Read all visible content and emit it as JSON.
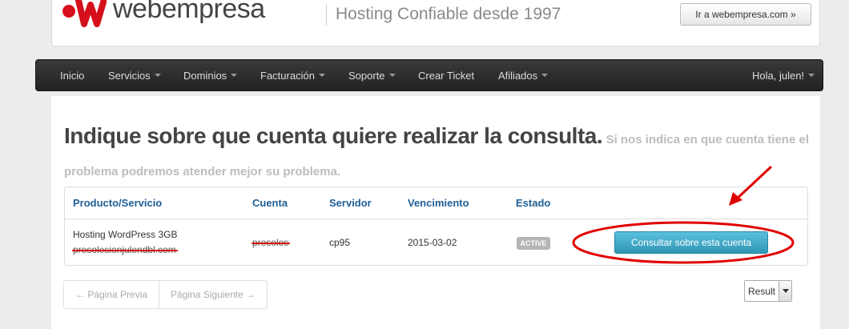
{
  "header": {
    "logo_text": "webempresa",
    "tagline": "Hosting Confiable desde 1997",
    "ir_button": "Ir a webempresa.com »"
  },
  "navbar": {
    "items": [
      {
        "label": "Inicio",
        "dropdown": false
      },
      {
        "label": "Servicios",
        "dropdown": true
      },
      {
        "label": "Dominios",
        "dropdown": true
      },
      {
        "label": "Facturación",
        "dropdown": true
      },
      {
        "label": "Soporte",
        "dropdown": true
      },
      {
        "label": "Crear Ticket",
        "dropdown": false
      },
      {
        "label": "Afiliados",
        "dropdown": true
      }
    ],
    "user": "Hola, julen!"
  },
  "main": {
    "heading": "Indique sobre que cuenta quiere realizar la consulta.",
    "subheading": "Si nos indica en que cuenta tiene el problema podremos atender mejor su problema."
  },
  "table": {
    "headers": [
      "Producto/Servicio",
      "Cuenta",
      "Servidor",
      "Vencimiento",
      "Estado"
    ],
    "rows": [
      {
        "product": "Hosting WordPress 3GB",
        "domain": "presolesionjulendbl.com",
        "account": "presolos",
        "server": "cp95",
        "expiry": "2015-03-02",
        "status": "ACTIVE",
        "action": "Consultar sobre esta cuenta"
      }
    ]
  },
  "pager": {
    "prev": "← Página Previa",
    "next": "Página Siguiente →"
  },
  "results_select": {
    "value": "Result"
  },
  "colors": {
    "navbar": "#2a2a2a",
    "link_blue": "#1f5e96",
    "button_info": "#49afcd",
    "annotation_red": "#e00000",
    "logo_red": "#d5101a"
  }
}
